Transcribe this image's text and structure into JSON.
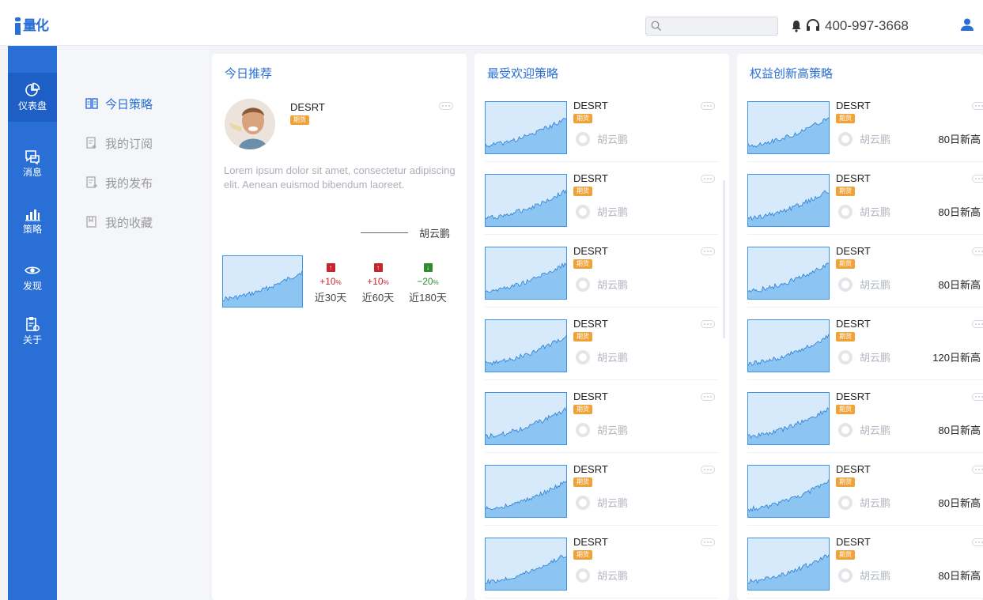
{
  "app": {
    "logo_text": "量化"
  },
  "header": {
    "search_placeholder": "",
    "phone": "400-997-3668"
  },
  "leftnav": {
    "items": [
      {
        "label": "仪表盘",
        "icon": "pie-chart-icon",
        "active": true
      },
      {
        "label": "消息",
        "icon": "message-icon"
      },
      {
        "label": "策略",
        "icon": "bar-chart-icon"
      },
      {
        "label": "发现",
        "icon": "eye-icon"
      },
      {
        "label": "关于",
        "icon": "clipboard-icon"
      }
    ]
  },
  "subnav": {
    "items": [
      {
        "label": "今日策略",
        "icon": "book-icon",
        "active": true
      },
      {
        "label": "我的订阅",
        "icon": "subscribe-icon"
      },
      {
        "label": "我的发布",
        "icon": "publish-icon"
      },
      {
        "label": "我的收藏",
        "icon": "bookmark-icon"
      }
    ]
  },
  "today": {
    "title": "今日推荐",
    "name": "DESRT",
    "tag": "期货",
    "description": "Lorem ipsum dolor sit amet, consectetur adipiscing elit. Aenean euismod bibendum laoreet.",
    "author": "胡云鹏",
    "performance": [
      {
        "direction": "up",
        "value": "+10",
        "unit": "%",
        "label": "近30天"
      },
      {
        "direction": "up",
        "value": "+10",
        "unit": "%",
        "label": "近60天"
      },
      {
        "direction": "down",
        "value": "−20",
        "unit": "%",
        "label": "近180天"
      }
    ]
  },
  "popular": {
    "title": "最受欢迎策略",
    "cards": [
      {
        "name": "DESRT",
        "tag": "期货",
        "author": "胡云鹏"
      },
      {
        "name": "DESRT",
        "tag": "期货",
        "author": "胡云鹏"
      },
      {
        "name": "DESRT",
        "tag": "期货",
        "author": "胡云鹏"
      },
      {
        "name": "DESRT",
        "tag": "期货",
        "author": "胡云鹏"
      },
      {
        "name": "DESRT",
        "tag": "期货",
        "author": "胡云鹏"
      },
      {
        "name": "DESRT",
        "tag": "期货",
        "author": "胡云鹏"
      },
      {
        "name": "DESRT",
        "tag": "期货",
        "author": "胡云鹏"
      }
    ]
  },
  "highs": {
    "title": "权益创新高策略",
    "cards": [
      {
        "name": "DESRT",
        "tag": "期货",
        "author": "胡云鹏",
        "high": "80日新高"
      },
      {
        "name": "DESRT",
        "tag": "期货",
        "author": "胡云鹏",
        "high": "80日新高"
      },
      {
        "name": "DESRT",
        "tag": "期货",
        "author": "胡云鹏",
        "high": "80日新高"
      },
      {
        "name": "DESRT",
        "tag": "期货",
        "author": "胡云鹏",
        "high": "120日新高"
      },
      {
        "name": "DESRT",
        "tag": "期货",
        "author": "胡云鹏",
        "high": "80日新高"
      },
      {
        "name": "DESRT",
        "tag": "期货",
        "author": "胡云鹏",
        "high": "80日新高"
      },
      {
        "name": "DESRT",
        "tag": "期货",
        "author": "胡云鹏",
        "high": "80日新高"
      }
    ]
  },
  "colors": {
    "primary": "#2a6fd6",
    "tag": "#f0a23a",
    "up": "#c8242c",
    "down": "#2e8b2e",
    "chart_fill": "#8cc4f2"
  }
}
